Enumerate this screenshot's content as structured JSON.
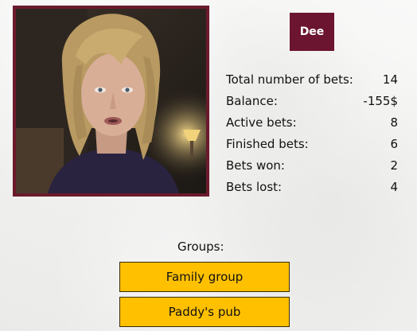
{
  "profile": {
    "name": "Dee"
  },
  "stats": [
    {
      "label": "Total number of bets:",
      "value": "14"
    },
    {
      "label": "Balance:",
      "value": "-155$"
    },
    {
      "label": "Active bets:",
      "value": "8"
    },
    {
      "label": "Finished bets:",
      "value": "6"
    },
    {
      "label": "Bets won:",
      "value": "2"
    },
    {
      "label": "Bets lost:",
      "value": "4"
    }
  ],
  "groups": {
    "label": "Groups:",
    "items": [
      "Family group",
      "Paddy's pub"
    ]
  },
  "colors": {
    "accent": "#6b1530",
    "button": "#ffc000"
  }
}
